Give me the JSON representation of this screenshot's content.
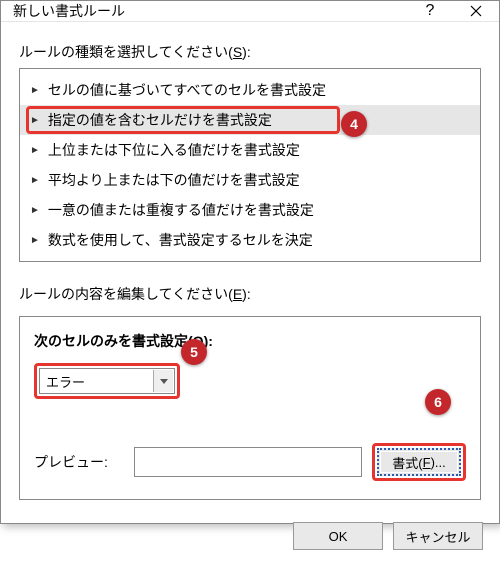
{
  "window": {
    "title": "新しい書式ルール"
  },
  "sections": {
    "rule_type_label_pre": "ルールの種類を選択してください(",
    "rule_type_label_u": "S",
    "rule_type_label_post": "):",
    "rule_content_label_pre": "ルールの内容を編集してください(",
    "rule_content_label_u": "E",
    "rule_content_label_post": "):"
  },
  "rule_types": [
    "セルの値に基づいてすべてのセルを書式設定",
    "指定の値を含むセルだけを書式設定",
    "上位または下位に入る値だけを書式設定",
    "平均より上または下の値だけを書式設定",
    "一意の値または重複する値だけを書式設定",
    "数式を使用して、書式設定するセルを決定"
  ],
  "selected_rule_index": 1,
  "content": {
    "subtitle_pre": "次のセルのみを書式設定(",
    "subtitle_u": "O",
    "subtitle_post": "):",
    "combo_value": "エラー",
    "preview_label": "プレビュー:",
    "format_button_pre": "書式(",
    "format_button_u": "F",
    "format_button_post": ")..."
  },
  "footer": {
    "ok": "OK",
    "cancel": "キャンセル"
  },
  "callouts": {
    "c4": "4",
    "c5": "5",
    "c6": "6"
  }
}
